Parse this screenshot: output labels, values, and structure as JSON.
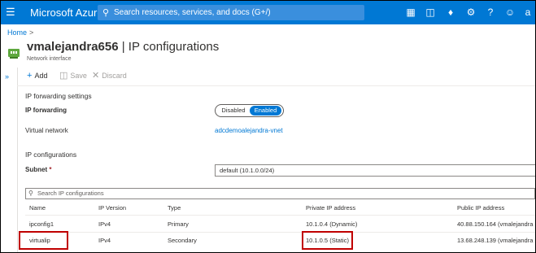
{
  "topbar": {
    "brand": "Microsoft Azure",
    "search_placeholder": "Search resources, services, and docs (G+/)",
    "accent_color": "#0078d4",
    "icons": [
      "cloud-shell-icon",
      "directory-filter-icon",
      "notifications-icon",
      "settings-icon",
      "help-icon",
      "feedback-icon"
    ],
    "account_initial": "a"
  },
  "breadcrumb": {
    "home": "Home",
    "separator": ">"
  },
  "page": {
    "resource_name": "vmalejandra656",
    "title_suffix": " | IP configurations",
    "subtitle": "Network interface"
  },
  "toolbar": {
    "add": "Add",
    "save": "Save",
    "discard": "Discard"
  },
  "ip_forwarding": {
    "section_title": "IP forwarding settings",
    "label": "IP forwarding",
    "options": [
      "Disabled",
      "Enabled"
    ],
    "selected": "Enabled"
  },
  "virtual_network": {
    "label": "Virtual network",
    "value": "adcdemoalejandra-vnet"
  },
  "ip_configurations": {
    "section_title": "IP configurations",
    "subnet_label": "Subnet",
    "required_marker": "*",
    "subnet_value": "default (10.1.0.0/24)",
    "filter_placeholder": "Search IP configurations",
    "columns": [
      "Name",
      "IP Version",
      "Type",
      "Private IP address",
      "Public IP address"
    ],
    "rows": [
      {
        "name": "ipconfig1",
        "version": "IPv4",
        "type": "Primary",
        "private_ip": "10.1.0.4 (Dynamic)",
        "public_ip": "40.88.150.164 (vmalejandra"
      },
      {
        "name": "virtualip",
        "version": "IPv4",
        "type": "Secondary",
        "private_ip": "10.1.0.5 (Static)",
        "public_ip": "13.68.248.139 (vmalejandra"
      }
    ],
    "highlight_color": "#c00000"
  }
}
